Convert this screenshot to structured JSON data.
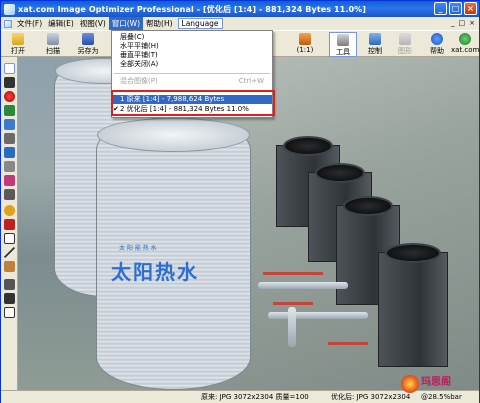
{
  "window": {
    "title": "xat.com  Image Optimizer Professional - [优化后 [1:4] - 881,324 Bytes 11.0%]",
    "minimize": "_",
    "maximize": "□",
    "close": "×"
  },
  "menubar": {
    "items": [
      "文件(F)",
      "编辑(E)",
      "视图(V)",
      "窗口(W)",
      "帮助(H)"
    ],
    "language": "Language",
    "child_controls": [
      "_",
      "□",
      "×"
    ]
  },
  "toolbar": {
    "open": "打开",
    "scan": "扫描",
    "save_as": "另存为",
    "zoom_ratio": "(1:1)",
    "tools": "工具",
    "control": "控制",
    "chart": "图形",
    "help": "帮助",
    "site": "xat.com"
  },
  "window_menu": {
    "items": [
      {
        "label": "层叠(C)",
        "shortcut": ""
      },
      {
        "label": "水平平铺(H)",
        "shortcut": ""
      },
      {
        "label": "垂直平铺(T)",
        "shortcut": ""
      },
      {
        "label": "全部关闭(A)",
        "shortcut": ""
      }
    ],
    "disabled_item": {
      "label": "混合图像(P)",
      "shortcut": "Ctrl+W"
    },
    "docs": [
      {
        "label": "1 原来 [1:4] - 7,988,624 Bytes",
        "checked": false
      },
      {
        "label": "2 优化后 [1:4] - 881,324 Bytes 11.0%",
        "checked": true
      }
    ],
    "check_mark": "✔"
  },
  "image": {
    "tank_label": "太阳热水",
    "tank_label_small": "太 阳 能 热 水"
  },
  "statusbar": {
    "original": "原来: JPG 3072x2304  质量=100",
    "optimized": "优化后: JPG 3072x2304",
    "zoom": "@28.5%bar"
  },
  "watermark": {
    "text": "玛思阁"
  },
  "colors": {
    "titlebar": "#0a5fd8",
    "menu_highlight": "#316ac5",
    "red_highlight_box": "#e0201a"
  }
}
